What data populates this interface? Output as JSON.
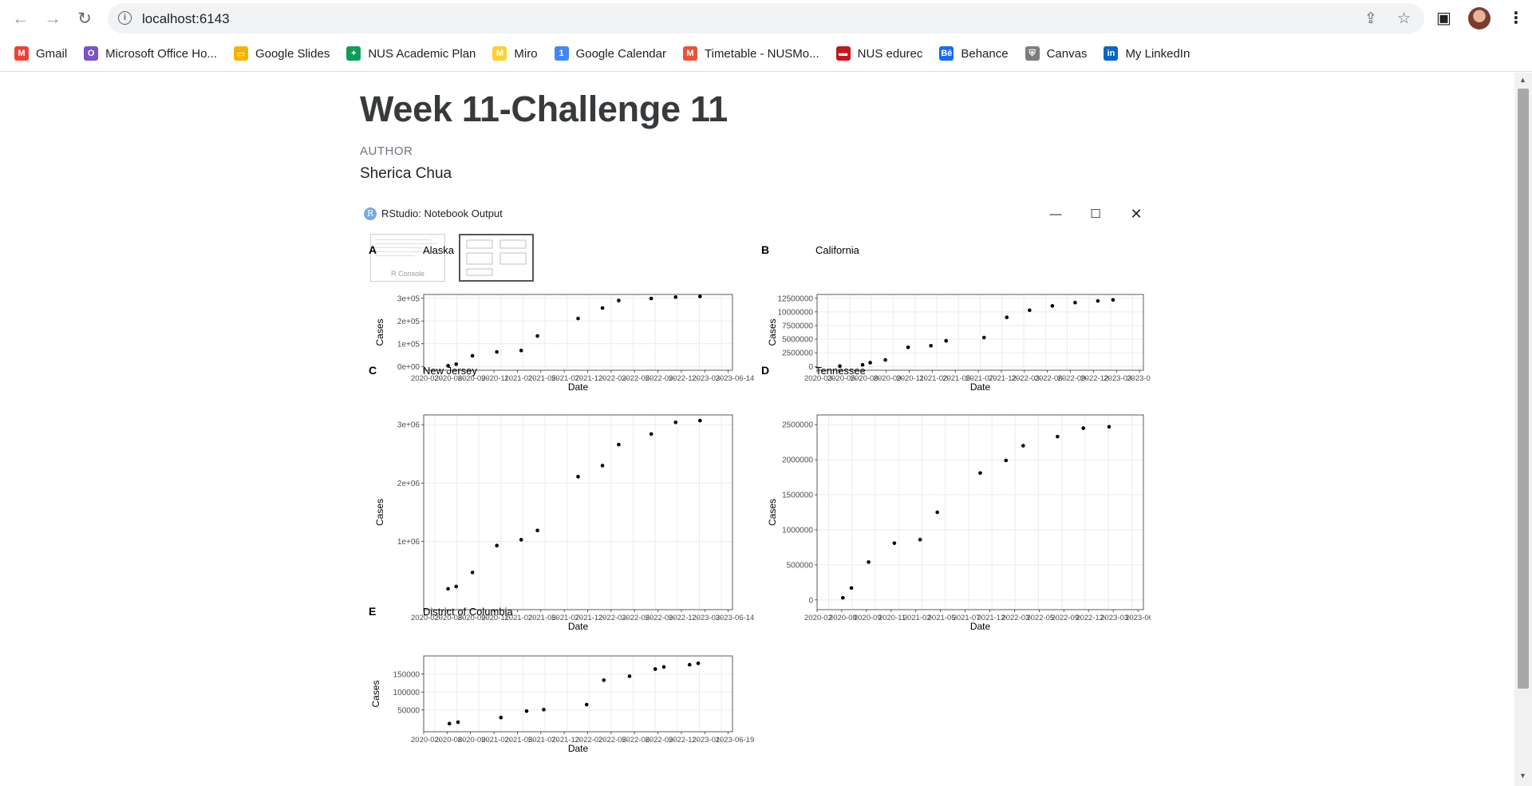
{
  "browser": {
    "url": "localhost:6143",
    "bookmarks": [
      {
        "label": "Gmail",
        "icon": "gmail-icon",
        "color": "#ea4335",
        "glyph": "M"
      },
      {
        "label": "Microsoft Office Ho...",
        "icon": "office-icon",
        "color": "#7b53c7",
        "glyph": "O"
      },
      {
        "label": "Google Slides",
        "icon": "slides-icon",
        "color": "#f4b400",
        "glyph": "▭"
      },
      {
        "label": "NUS Academic Plan",
        "icon": "sheets-icon",
        "color": "#0f9d58",
        "glyph": "+"
      },
      {
        "label": "Miro",
        "icon": "miro-icon",
        "color": "#ffd02f",
        "glyph": "M"
      },
      {
        "label": "Google Calendar",
        "icon": "calendar-icon",
        "color": "#4285f4",
        "glyph": "1"
      },
      {
        "label": "Timetable - NUSMo...",
        "icon": "nusmods-icon",
        "color": "#e8533a",
        "glyph": "M"
      },
      {
        "label": "NUS edurec",
        "icon": "edurec-icon",
        "color": "#c4161c",
        "glyph": "▬"
      },
      {
        "label": "Behance",
        "icon": "behance-icon",
        "color": "#1769ff",
        "glyph": "Bē"
      },
      {
        "label": "Canvas",
        "icon": "canvas-icon",
        "color": "#7d7d7d",
        "glyph": "⛨"
      },
      {
        "label": "My LinkedIn",
        "icon": "linkedin-icon",
        "color": "#0a66c2",
        "glyph": "in"
      }
    ]
  },
  "document": {
    "title": "Week 11-Challenge 11",
    "author_label": "AUTHOR",
    "author_name": "Sherica Chua"
  },
  "notebook": {
    "window_title": "RStudio: Notebook Output",
    "thumb_console_label": "R Console"
  },
  "chart_data": [
    {
      "type": "scatter",
      "tag": "A",
      "title": "Alaska",
      "xlabel": "Date",
      "ylabel": "Cases",
      "x_tick_labels": [
        "2020-02-",
        "2020-08-",
        "2020-09-",
        "2020-11-",
        "2021-02-",
        "2021-05-",
        "2021-07-",
        "2021-12-",
        "2022-03-",
        "2022-05-",
        "2022-09-",
        "2022-12-",
        "2023-03-",
        "2023-06-14"
      ],
      "y_ticks": [
        "0e+00",
        "1e+05",
        "2e+05",
        "3e+05"
      ],
      "ylim": [
        0,
        300000
      ],
      "x": [
        "2020-08",
        "2020-09",
        "2020-11",
        "2021-02",
        "2021-05",
        "2021-07",
        "2021-12",
        "2022-03",
        "2022-05",
        "2022-09",
        "2022-12",
        "2023-03"
      ],
      "values": [
        3000,
        10000,
        47000,
        64000,
        70000,
        134000,
        211000,
        257000,
        290000,
        299000,
        305000,
        308000
      ]
    },
    {
      "type": "scatter",
      "tag": "B",
      "title": "California",
      "xlabel": "Date",
      "ylabel": "Cases",
      "x_tick_labels": [
        "2020-03-",
        "2020-05-",
        "2020-08-",
        "2020-09-",
        "2020-11-",
        "2021-02-",
        "2021-05-",
        "2021-07-",
        "2021-12-",
        "2022-03-",
        "2022-06-",
        "2022-09-",
        "2022-12-",
        "2023-03-",
        "2023-05-09"
      ],
      "y_ticks": [
        "0",
        "2500000",
        "5000000",
        "7500000",
        "10000000",
        "12500000"
      ],
      "ylim": [
        0,
        12500000
      ],
      "x": [
        "2020-05",
        "2020-08",
        "2020-09",
        "2020-11",
        "2021-02",
        "2021-05",
        "2021-07",
        "2021-12",
        "2022-03",
        "2022-06",
        "2022-09",
        "2022-12",
        "2023-03",
        "2023-05"
      ],
      "values": [
        60000,
        300000,
        700000,
        1200000,
        3500000,
        3800000,
        4700000,
        5300000,
        9000000,
        10300000,
        11100000,
        11700000,
        12000000,
        12200000
      ]
    },
    {
      "type": "scatter",
      "tag": "C",
      "title": "New Jersey",
      "xlabel": "Date",
      "ylabel": "Cases",
      "x_tick_labels": [
        "2020-02-",
        "2020-08-",
        "2020-09-",
        "2020-11-",
        "2021-02-",
        "2021-05-",
        "2021-07-",
        "2021-12-",
        "2022-03-",
        "2022-05-",
        "2022-09-",
        "2022-12-",
        "2023-03-",
        "2023-06-14"
      ],
      "y_ticks": [
        "1e+06",
        "2e+06",
        "3e+06"
      ],
      "ylim": [
        0,
        3000000
      ],
      "x": [
        "2020-08",
        "2020-09",
        "2020-11",
        "2021-02",
        "2021-05",
        "2021-07",
        "2021-12",
        "2022-03",
        "2022-05",
        "2022-09",
        "2022-12",
        "2023-03"
      ],
      "values": [
        190000,
        230000,
        470000,
        930000,
        1030000,
        1190000,
        2110000,
        2300000,
        2660000,
        2840000,
        3040000,
        3070000
      ]
    },
    {
      "type": "scatter",
      "tag": "D",
      "title": "Tennessee",
      "xlabel": "Date",
      "ylabel": "Cases",
      "x_tick_labels": [
        "2020-02-",
        "2020-08-",
        "2020-09-",
        "2020-11-",
        "2021-02-",
        "2021-05-",
        "2021-07-",
        "2021-12-",
        "2022-03-",
        "2022-05-",
        "2022-09-",
        "2022-12-",
        "2023-03-",
        "2023-06-14"
      ],
      "y_ticks": [
        "0",
        "500000",
        "1000000",
        "1500000",
        "2000000",
        "2500000"
      ],
      "ylim": [
        0,
        2500000
      ],
      "x": [
        "2020-08",
        "2020-09",
        "2020-11",
        "2021-02",
        "2021-05",
        "2021-07",
        "2021-12",
        "2022-03",
        "2022-05",
        "2022-09",
        "2022-12",
        "2023-03"
      ],
      "values": [
        30000,
        170000,
        540000,
        810000,
        860000,
        1250000,
        1810000,
        1990000,
        2200000,
        2330000,
        2450000,
        2470000
      ]
    },
    {
      "type": "scatter",
      "tag": "E",
      "title": "District of Columbia",
      "xlabel": "Date",
      "ylabel": "Cases",
      "x_tick_labels": [
        "2020-02-",
        "2020-08-",
        "2020-09-",
        "2021-02-",
        "2021-05-",
        "2021-07-",
        "2021-12-",
        "2022-02-",
        "2022-05-",
        "2022-08-",
        "2022-09-",
        "2022-12-",
        "2023-01-",
        "2023-06-19"
      ],
      "y_ticks": [
        "50000",
        "100000",
        "150000"
      ],
      "ylim": [
        0,
        190000
      ],
      "x": [
        "2020-08",
        "2020-09",
        "2021-02",
        "2021-05",
        "2021-07",
        "2021-12",
        "2022-02",
        "2022-05",
        "2022-08",
        "2022-09",
        "2022-12",
        "2023-01"
      ],
      "values": [
        12000,
        16000,
        29000,
        47000,
        51000,
        65000,
        133000,
        144000,
        164000,
        170000,
        176000,
        180000
      ]
    }
  ]
}
